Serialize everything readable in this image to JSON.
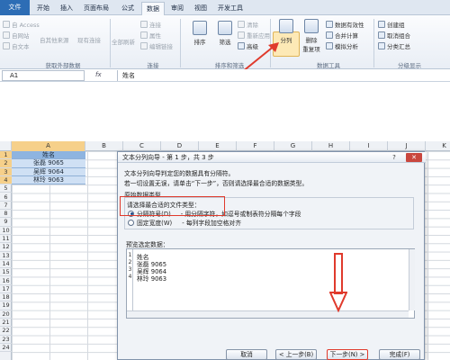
{
  "ribbon_tabs": [
    "文件",
    "开始",
    "插入",
    "页面布局",
    "公式",
    "数据",
    "审阅",
    "视图",
    "开发工具"
  ],
  "ribbon": {
    "get_external": {
      "items": [
        "自 Access",
        "自网站",
        "自文本",
        "自其他来源",
        "现有连接"
      ],
      "group_label": "获取外部数据"
    },
    "connections": {
      "refresh_all": "全部刷新",
      "items": [
        "连接",
        "属性",
        "编辑链接"
      ],
      "group_label": "连接"
    },
    "sort_filter": {
      "sort": "排序",
      "filter": "筛选",
      "items": [
        "清除",
        "重新应用",
        "高级"
      ],
      "group_label": "排序和筛选"
    },
    "data_tools": {
      "split": "分列",
      "remove_dup": "删除\n重复项",
      "items": [
        "数据有效性",
        "合并计算",
        "模拟分析"
      ],
      "group_label": "数据工具"
    },
    "outline": {
      "items": [
        "创建组",
        "取消组合",
        "分类汇总"
      ],
      "group_label": "分级显示"
    }
  },
  "formula_bar": {
    "name_box": "A1",
    "fx": "fx",
    "formula": "姓名"
  },
  "grid": {
    "columns": [
      "A",
      "B",
      "C",
      "D",
      "E",
      "F",
      "G",
      "H",
      "I",
      "J",
      "K"
    ],
    "rows": [
      "1",
      "2",
      "3",
      "4",
      "5",
      "6",
      "7",
      "8",
      "9",
      "10",
      "11",
      "12",
      "13",
      "14",
      "15",
      "16",
      "17",
      "18",
      "19",
      "20",
      "21",
      "22",
      "23",
      "24"
    ],
    "cells": [
      "姓名",
      "张磊 9065",
      "吴辉 9064",
      "林玲 9063"
    ]
  },
  "dialog": {
    "title": "文本分列向导 - 第 1 步，共 3 步",
    "help": "?",
    "close": "✕",
    "intro_1": "文本分列向导判定您的数据具有分隔符。",
    "intro_2": "若一切设置无误，请单击“下一步”，否则请选择最合适的数据类型。",
    "section_title": "原始数据类型",
    "choose_label": "请选择最合适的文件类型：",
    "option_delimited": "分隔符号(D)",
    "option_delimited_desc": "- 用分隔字符，如逗号或制表符分隔每个字段",
    "option_fixed": "固定宽度(W)",
    "option_fixed_desc": "- 每列字段加空格对齐",
    "preview_title": "预览选定数据：",
    "preview_lines": [
      {
        "num": "1",
        "text": "姓名"
      },
      {
        "num": "2",
        "text": "张磊 9065"
      },
      {
        "num": "3",
        "text": "吴辉 9064"
      },
      {
        "num": "4",
        "text": "林玲 9063"
      }
    ],
    "buttons": {
      "cancel": "取消",
      "back": "< 上一步(B)",
      "next": "下一步(N) >",
      "finish": "完成(F)"
    }
  },
  "annotation_color": "#e03a2c"
}
